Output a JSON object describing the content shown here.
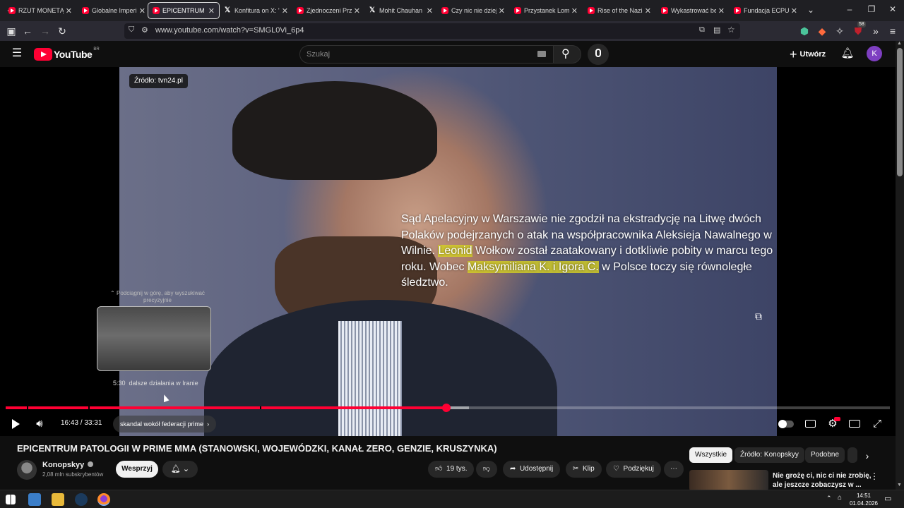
{
  "browser": {
    "tabs": [
      {
        "label": "RZUT MONETĄ DE",
        "favicon": "youtube-icon",
        "active": false
      },
      {
        "label": "Globalne Imperium",
        "favicon": "youtube-icon",
        "active": false
      },
      {
        "label": "EPICENTRUM PATO",
        "favicon": "youtube-icon",
        "active": true
      },
      {
        "label": "Konfitura on X: \"P",
        "favicon": "x-icon",
        "active": false
      },
      {
        "label": "Zjednoczeni Przec",
        "favicon": "youtube-icon",
        "active": false
      },
      {
        "label": "Mohit Chauhan on",
        "favicon": "x-icon",
        "active": false
      },
      {
        "label": "Czy nic nie dzieje s",
        "favicon": "youtube-icon",
        "active": false
      },
      {
        "label": "Przystanek Lomba",
        "favicon": "youtube-icon",
        "active": false
      },
      {
        "label": "Rise of the Nazis a",
        "favicon": "youtube-icon",
        "active": false
      },
      {
        "label": "Wykastrować bezc",
        "favicon": "youtube-icon",
        "active": false
      },
      {
        "label": "Fundacja ECPU Po",
        "favicon": "youtube-icon",
        "active": false
      }
    ],
    "url": "www.youtube.com/watch?v=SMGL0Vi_6p4",
    "extension_badge": "58"
  },
  "youtube": {
    "logo_text": "YouTube",
    "region": "BR",
    "search_placeholder": "Szukaj",
    "create_label": "Utwórz",
    "avatar_letter": "K"
  },
  "player": {
    "source_badge": "Źródło: tvn24.pl",
    "caption_parts": [
      {
        "text": "Sąd Apelacyjny w Warszawie nie zgodził na ekstradycję na Litwę dwóch Polaków podejrzanych o atak na współpracownika Aleksieja Nawalnego w Wilnie. ",
        "highlight": false
      },
      {
        "text": "Leonid",
        "highlight": true
      },
      {
        "text": " Wołkow został zaatakowany i dotkliwie pobity w marcu tego roku. Wobec ",
        "highlight": false
      },
      {
        "text": "Maksymiliana K. i Igora C.",
        "highlight": true
      },
      {
        "text": " w Polsce toczy się równoległe śledztwo.",
        "highlight": false
      }
    ],
    "preview_hint": "Podciągnij w górę, aby wyszukiwać precyzyjnie",
    "preview_time": "5:30",
    "preview_chapter": "dalsze działania w Iranie",
    "time_current": "16:43",
    "time_total": "33:31",
    "time_display": "16:43 / 33:31",
    "chapter_label": "skandal wokół federacji prime",
    "progress_fraction": 0.4987,
    "buffered_fraction": 0.5236
  },
  "video": {
    "title": "EPICENTRUM PATOLOGII W PRIME MMA (STANOWSKI, WOJEWÓDZKI, KANAŁ ZERO, GENZIE, KRUSZYNKA)",
    "channel_name": "Konopskyy",
    "subscribers": "2,08 mln subskrybentów",
    "support_label": "Wesprzyj",
    "likes": "19 tys.",
    "share_label": "Udostępnij",
    "clip_label": "Klip",
    "thanks_label": "Podziękuj"
  },
  "sidebar": {
    "chips": [
      "Wszystkie",
      "Źródło: Konopskyy",
      "Podobne"
    ],
    "recommendation_title": "Nie grożę ci, nic ci nie zrobię, ale jeszcze zobaczysz w ..."
  },
  "taskbar": {
    "time": "14:51",
    "date": "01.04.2026"
  },
  "colors": {
    "accent": "#ff0033",
    "background": "#0f0f0f",
    "caption_highlight": "#d2cd28"
  }
}
